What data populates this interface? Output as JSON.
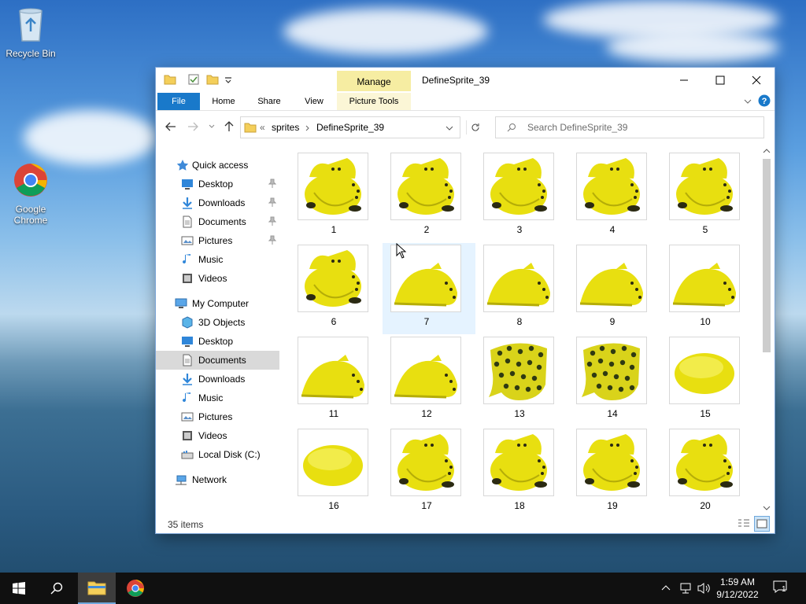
{
  "desktop": {
    "icons": [
      {
        "label": "Recycle Bin"
      },
      {
        "label": "Google Chrome"
      }
    ]
  },
  "window": {
    "title": "DefineSprite_39",
    "manage_label": "Manage",
    "ribbon_tabs": [
      "File",
      "Home",
      "Share",
      "View",
      "Picture Tools"
    ],
    "breadcrumb": [
      "sprites",
      "DefineSprite_39"
    ],
    "breadcrumb_overflow": "«",
    "search_placeholder": "Search DefineSprite_39",
    "status": "35 items",
    "accent": "#1979ca"
  },
  "nav": {
    "quick_access": "Quick access",
    "quick_items": [
      {
        "label": "Desktop",
        "pinned": true,
        "icon": "desktop-icon"
      },
      {
        "label": "Downloads",
        "pinned": true,
        "icon": "downloads-icon"
      },
      {
        "label": "Documents",
        "pinned": true,
        "icon": "documents-icon"
      },
      {
        "label": "Pictures",
        "pinned": true,
        "icon": "pictures-icon"
      },
      {
        "label": "Music",
        "pinned": false,
        "icon": "music-icon"
      },
      {
        "label": "Videos",
        "pinned": false,
        "icon": "videos-icon"
      }
    ],
    "computer": "My Computer",
    "computer_items": [
      {
        "label": "3D Objects",
        "icon": "3d-objects-icon"
      },
      {
        "label": "Desktop",
        "icon": "desktop-icon"
      },
      {
        "label": "Documents",
        "icon": "documents-icon",
        "selected": true
      },
      {
        "label": "Downloads",
        "icon": "downloads-icon"
      },
      {
        "label": "Music",
        "icon": "music-icon"
      },
      {
        "label": "Pictures",
        "icon": "pictures-icon"
      },
      {
        "label": "Videos",
        "icon": "videos-icon"
      },
      {
        "label": "Local Disk (C:)",
        "icon": "local-disk-icon"
      }
    ],
    "network": "Network"
  },
  "files": [
    {
      "name": "1",
      "kind": "front"
    },
    {
      "name": "2",
      "kind": "front"
    },
    {
      "name": "3",
      "kind": "front"
    },
    {
      "name": "4",
      "kind": "front"
    },
    {
      "name": "5",
      "kind": "front"
    },
    {
      "name": "6",
      "kind": "front"
    },
    {
      "name": "7",
      "kind": "side"
    },
    {
      "name": "8",
      "kind": "side"
    },
    {
      "name": "9",
      "kind": "side"
    },
    {
      "name": "10",
      "kind": "side"
    },
    {
      "name": "11",
      "kind": "side"
    },
    {
      "name": "12",
      "kind": "side"
    },
    {
      "name": "13",
      "kind": "spotted"
    },
    {
      "name": "14",
      "kind": "spotted"
    },
    {
      "name": "15",
      "kind": "blob"
    },
    {
      "name": "16",
      "kind": "blob"
    },
    {
      "name": "17",
      "kind": "front"
    },
    {
      "name": "18",
      "kind": "front"
    },
    {
      "name": "19",
      "kind": "front"
    },
    {
      "name": "20",
      "kind": "front"
    }
  ],
  "hovered_file": "7",
  "taskbar": {
    "time": "1:59 AM",
    "date": "9/12/2022",
    "notification_count": "1"
  }
}
